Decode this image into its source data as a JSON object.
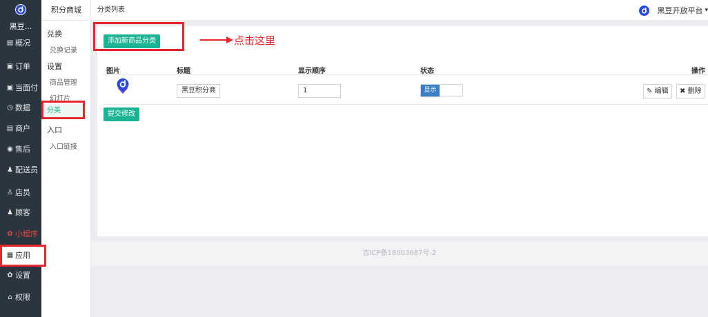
{
  "sidebar": {
    "shop_name": "黑豆...",
    "items": [
      {
        "icon": "overview-icon",
        "glyph": "▤",
        "label": "概况"
      },
      {
        "icon": "order-icon",
        "glyph": "▣",
        "label": "订单"
      },
      {
        "icon": "face-pay-icon",
        "glyph": "▣",
        "label": "当面付"
      },
      {
        "icon": "data-icon",
        "glyph": "◷",
        "label": "数据"
      },
      {
        "icon": "merchant-icon",
        "glyph": "▤",
        "label": "商户"
      },
      {
        "icon": "after-sale-icon",
        "glyph": "◉",
        "label": "售后"
      },
      {
        "icon": "courier-icon",
        "glyph": "♟",
        "label": "配送员"
      },
      {
        "icon": "clerk-icon",
        "glyph": "♙",
        "label": "店员"
      },
      {
        "icon": "customer-icon",
        "glyph": "♟",
        "label": "顾客"
      },
      {
        "icon": "mini-program-icon",
        "glyph": "✿",
        "label": "小程序"
      },
      {
        "icon": "apps-icon",
        "glyph": "▦",
        "label": "应用"
      },
      {
        "icon": "settings-icon",
        "glyph": "✿",
        "label": "设置"
      },
      {
        "icon": "permission-icon",
        "glyph": "⌂",
        "label": "权限"
      }
    ]
  },
  "submenu": {
    "title": "积分商城",
    "exchange": "兑换",
    "exchange_records": "兑换记录",
    "settings": "设置",
    "goods_manage": "商品管理",
    "slides": "幻灯片",
    "category": "分类",
    "entry": "入口",
    "entry_link": "入口链接"
  },
  "topbar": {
    "page_title": "分类列表",
    "platform_name": "黑豆开放平台",
    "caret": "▾"
  },
  "main": {
    "add_category_button": "添加新商品分类",
    "columns": {
      "image": "图片",
      "title": "标题",
      "order": "显示顺序",
      "status": "状态",
      "actions": "操作"
    },
    "row": {
      "title_value": "黑豆积分商",
      "order_value": "1",
      "status_label": "显示",
      "edit_label": "编辑",
      "delete_label": "删除"
    },
    "submit_button": "提交修改",
    "footer": "吉ICP备18003687号-2"
  },
  "annotation": {
    "text": "点击这里"
  },
  "colors": {
    "sidebar_bg": "#2a3540",
    "accent_green": "#1ab394",
    "status_blue": "#3a7fc1",
    "annotation_red": "#e8262d",
    "brand_blue": "#2c4bd8"
  }
}
